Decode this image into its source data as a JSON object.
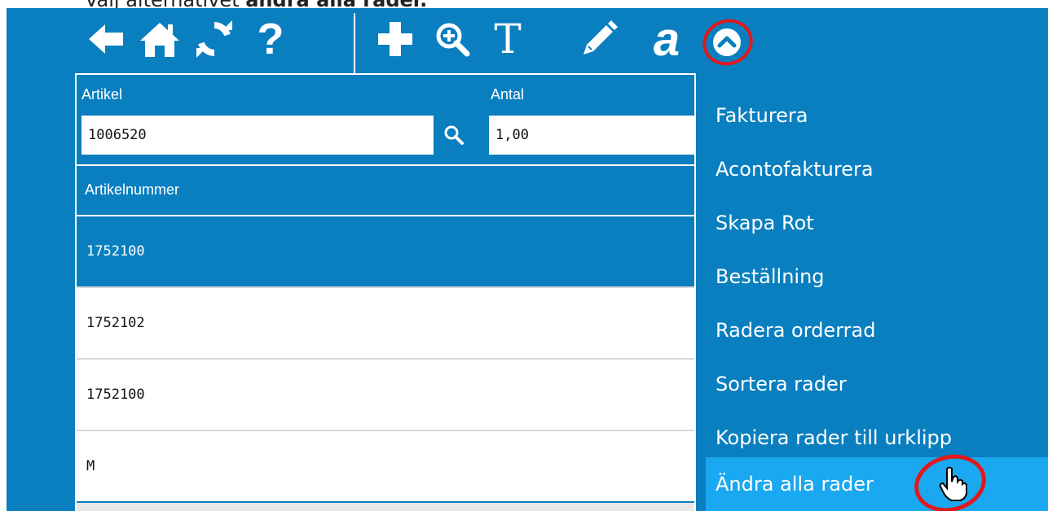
{
  "caption": {
    "prefix": "Välj alternativet ",
    "bold": "ändra alla rader."
  },
  "toolbar": {
    "icons": [
      "back-arrow-icon",
      "home-icon",
      "refresh-icon",
      "help-icon",
      "add-icon",
      "zoom-in-icon",
      "text-icon",
      "pencil-icon",
      "font-a-icon",
      "chevron-up-icon"
    ],
    "help_label": "?",
    "text_label": "T",
    "font_label": "a"
  },
  "form": {
    "artikel_label": "Artikel",
    "artikel_value": "1006520",
    "antal_label": "Antal",
    "antal_value": "1,00"
  },
  "grid": {
    "header": "Artikelnummer",
    "rows": [
      "1752100",
      "1752102",
      "1752100",
      "M"
    ],
    "selected_index": 0
  },
  "menu": {
    "items": [
      "Fakturera",
      "Acontofakturera",
      "Skapa Rot",
      "Beställning",
      "Radera orderrad",
      "Sortera rader",
      "Kopiera rader till urklipp",
      "Ändra alla rader"
    ],
    "highlighted_index": 7
  },
  "colors": {
    "app_bg": "#0a7fbf",
    "highlight": "#1aa8f0",
    "annotation": "#e0191c"
  }
}
